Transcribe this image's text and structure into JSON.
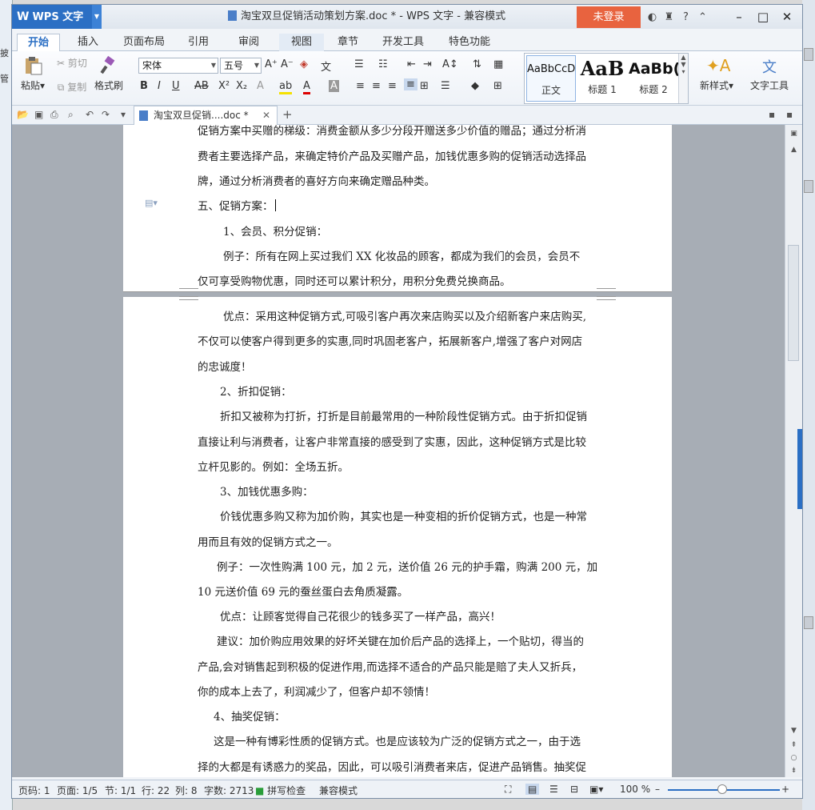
{
  "app": {
    "logo": "WPS 文字",
    "title": "淘宝双旦促销活动策划方案.doc * - WPS 文字 - 兼容模式",
    "login_label": "未登录",
    "help_label": "?"
  },
  "tabs": [
    "开始",
    "插入",
    "页面布局",
    "引用",
    "审阅",
    "视图",
    "章节",
    "开发工具",
    "特色功能"
  ],
  "ribbon": {
    "paste": "粘贴",
    "cut": "剪切",
    "copy": "复制",
    "format_painter": "格式刷",
    "font_name": "宋体",
    "font_size": "五号",
    "new_style": "新样式",
    "text_tools": "文字工具",
    "styles": [
      {
        "sample": "AaBbCcD",
        "name": "正文"
      },
      {
        "sample": "AaB",
        "name": "标题 1"
      },
      {
        "sample": "AaBb(",
        "name": "标题 2"
      }
    ]
  },
  "doc_tab": {
    "label": "淘宝双旦促销....doc *"
  },
  "page1": {
    "lines": [
      "促销方案中买赠的梯级：消费金额从多少分段开赠送多少价值的赠品；通过分析消",
      "费者主要选择产品，来确定特价产品及买赠产品，加钱优惠多购的促销活动选择品",
      "牌，通过分析消费者的喜好方向来确定赠品种类。",
      "五、促销方案：",
      "1、会员、积分促销：",
      "例子：所有在网上买过我们 XX 化妆品的顾客，都成为我们的会员，会员不",
      "仅可享受购物优惠，同时还可以累计积分，用积分免费兑换商品。"
    ]
  },
  "page2": {
    "lines": [
      "优点：采用这种促销方式,可吸引客户再次来店购买以及介绍新客户来店购买,",
      "不仅可以使客户得到更多的实惠,同时巩固老客户，拓展新客户,增强了客户对网店",
      "的忠诚度！",
      "2、折扣促销：",
      "折扣又被称为打折，打折是目前最常用的一种阶段性促销方式。由于折扣促销",
      "直接让利与消费者，让客户非常直接的感受到了实惠，因此，这种促销方式是比较",
      "立杆见影的。例如：全场五折。",
      "3、加钱优惠多购：",
      "价钱优惠多购又称为加价购，其实也是一种变相的折价促销方式，也是一种常",
      "用而且有效的促销方式之一。",
      "例子：一次性购满 100 元，加 2 元，送价值 26 元的护手霜，购满 200 元，加",
      "10 元送价值 69 元的蚕丝蛋白去角质凝露。",
      "优点：让顾客觉得自己花很少的钱多买了一样产品，高兴！",
      "建议：加价购应用效果的好坏关键在加价后产品的选择上，一个贴切，得当的",
      "产品,会对销售起到积极的促进作用,而选择不适合的产品只能是赔了夫人又折兵，",
      "你的成本上去了，利润减少了，但客户却不领情！",
      "4、抽奖促销：",
      "这是一种有博彩性质的促销方式。也是应该较为广泛的促销方式之一，由于选",
      "择的大都是有诱惑力的奖品，因此，可以吸引消费者来店，促进产品销售。抽奖促"
    ]
  },
  "status": {
    "page_code": "页码: 1",
    "pages": "页面: 1/5",
    "section": "节: 1/1",
    "row": "行: 22",
    "col": "列: 8",
    "words": "字数: 2713",
    "spell": "拼写检查",
    "compat": "兼容模式",
    "zoom": "100 %"
  },
  "bg_left_labels": [
    "披",
    "管"
  ]
}
